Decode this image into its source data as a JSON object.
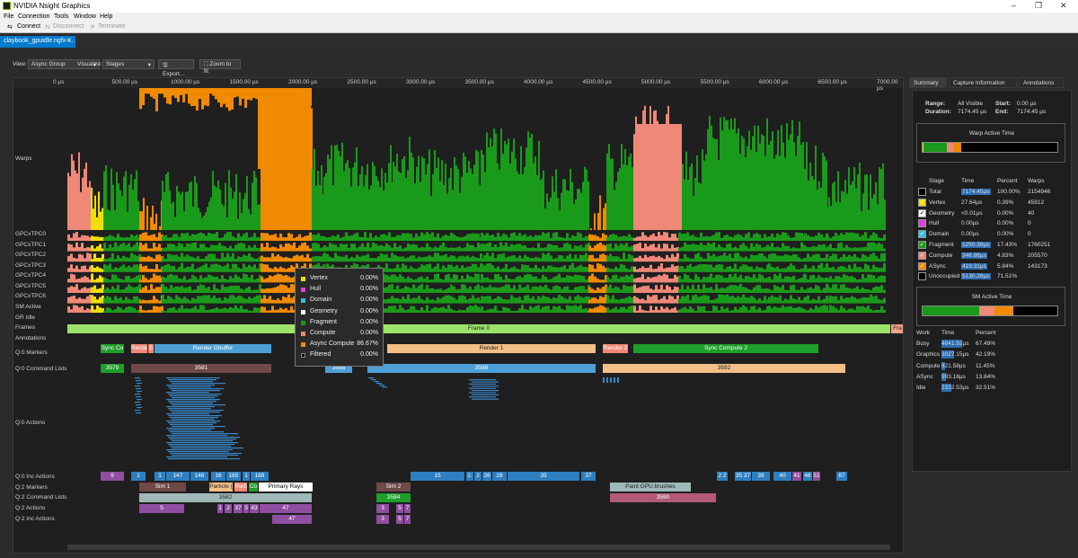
{
  "app": {
    "title": "NVIDIA Nsight Graphics",
    "menu": [
      "File",
      "Connection",
      "Tools",
      "Window",
      "Help"
    ],
    "toolbar": {
      "connect": "Connect",
      "disconnect": "Disconnect",
      "terminate": "Terminate"
    }
  },
  "document_tab": {
    "label": "claybook_gpuidle.ngfx-..."
  },
  "view_options": {
    "view_label": "View:",
    "view_value": "Async Group",
    "visualize_label": "Visualize:",
    "visualize_value": "Stages",
    "export_label": "Export...",
    "zoom_label": "Zoom to fit"
  },
  "timeline": {
    "ruler_ticks": [
      "0 µs",
      "500.00 µs",
      "1000.00 µs",
      "1500.00 µs",
      "2000.00 µs",
      "2500.00 µs",
      "3000.00 µs",
      "3500.00 µs",
      "4000.00 µs",
      "4500.00 µs",
      "5000.00 µs",
      "5500.00 µs",
      "6000.00 µs",
      "6500.00 µs",
      "7000.00 µs"
    ],
    "row_labels": {
      "warps": "Warps",
      "tpc": [
        "GPCxTPC0",
        "GPCxTPC1",
        "GPCxTPC2",
        "GPCxTPC3",
        "GPCxTPC4",
        "GPCxTPC5",
        "GPCxTPC6"
      ],
      "sm_active": "SM Active",
      "gr_idle": "GR Idle",
      "frames": "Frames",
      "annotations": "Annotations",
      "q0_markers": "Q:0 Markers",
      "q0_cmdlists": "Q:0 Command Lists",
      "q0_actions": "Q:0 Actions",
      "q0_inc_actions": "Q:0 Inc Actions",
      "q2_markers": "Q:2 Markers",
      "q2_cmdlists": "Q:2 Command Lists",
      "q2_actions": "Q:2 Actions",
      "q2_inc_actions": "Q:2 Inc Actions"
    },
    "frame_label": "Frame 0",
    "frame_label_end": "Fra",
    "q0_markers": {
      "sync_c0": "Sync Co",
      "render_short": "Rende",
      "render_5": "5",
      "render_gbuffer": "Render Gbuffer",
      "render_1": "Render 1",
      "render_2": "Render 2",
      "sync_compute_2": "Sync Compute 2"
    },
    "q0_cmdlists": {
      "a": "3579",
      "b": "3581",
      "c": "3588",
      "d": "3592",
      "mid": "3586"
    },
    "q0_inc": {
      "n9": "9",
      "n1": "1",
      "n1b": "1",
      "n147": "147",
      "n148": "148",
      "n16": "16",
      "n165": "165",
      "n1c": "1",
      "n188": "188",
      "n15": "15",
      "n1x": "1:",
      "n2": "2",
      "n26": "26",
      "n28": "28",
      "n35": "35",
      "n37": "37",
      "n22": "2 2",
      "n3537": "35 37",
      "n39": "39",
      "n40": "40",
      "n41": "41",
      "n46": "46",
      "n51": "51",
      "n87": "87"
    },
    "q2_markers": {
      "sim1": "Sim 1",
      "particle": "Particle (",
      "parti": "Parti",
      "co": "Co",
      "primary_rays": "Primary Rays",
      "sim2": "Sim 2",
      "paint": "Paint GPU brushes"
    },
    "q2_cmdlists": {
      "a": "3582",
      "b": "3584",
      "c": "3590"
    },
    "q2_actions": {
      "a": "5",
      "b": "1",
      "c": "2",
      "d": "37",
      "e": "3",
      "f": "43",
      "g": "47",
      "h": "3",
      "i": "5",
      "j": "7"
    },
    "q2_inc": {
      "a": "47",
      "b": "3",
      "c": "5",
      "d": "7"
    }
  },
  "tooltip": {
    "items": [
      {
        "name": "Vertex",
        "pct": "0.00%",
        "color": "#f0e000"
      },
      {
        "name": "Hull",
        "pct": "0.00%",
        "color": "#e040e0"
      },
      {
        "name": "Domain",
        "pct": "0.00%",
        "color": "#30c0e0"
      },
      {
        "name": "Geometry",
        "pct": "0.00%",
        "color": "#ffffff"
      },
      {
        "name": "Fragment",
        "pct": "0.00%",
        "color": "#1a9a1a"
      },
      {
        "name": "Compute",
        "pct": "0.00%",
        "color": "#f08878"
      },
      {
        "name": "Async Compute",
        "pct": "86.67%",
        "color": "#f08a00"
      },
      {
        "name": "Filtered",
        "pct": "0.00%",
        "color": "#000000"
      }
    ]
  },
  "right_panel": {
    "tabs": [
      "Summary",
      "Capture Information",
      "Annotations"
    ],
    "range_label": "Range:",
    "range_value": "All Visible",
    "start_label": "Start:",
    "start_value": "0.00 µs",
    "duration_label": "Duration:",
    "duration_value": "7174.45 µs",
    "end_label": "End:",
    "end_value": "7174.45 µs",
    "warp_active_title": "Warp Active Time",
    "stage_headers": [
      "Stage",
      "Time",
      "Percent",
      "Warps"
    ],
    "stages": [
      {
        "name": "Total",
        "time": "7174.45µs",
        "percent": "100.00%",
        "warps": "2154946",
        "color": "#000000",
        "checked": false
      },
      {
        "name": "Vertex",
        "time": "27.64µs",
        "percent": "0.39%",
        "warps": "45912",
        "color": "#f0e000",
        "checked": true
      },
      {
        "name": "Geometry",
        "time": "<0.01µs",
        "percent": "0.00%",
        "warps": "40",
        "color": "#ffffff",
        "checked": true
      },
      {
        "name": "Hull",
        "time": "0.00µs",
        "percent": "0.00%",
        "warps": "0",
        "color": "#e040e0",
        "checked": false
      },
      {
        "name": "Domain",
        "time": "0.00µs",
        "percent": "0.00%",
        "warps": "0",
        "color": "#30c0e0",
        "checked": true
      },
      {
        "name": "Fragment",
        "time": "1250.38µs",
        "percent": "17.43%",
        "warps": "1760251",
        "color": "#1a9a1a",
        "checked": true
      },
      {
        "name": "Compute",
        "time": "346.86µs",
        "percent": "4.83%",
        "warps": "205570",
        "color": "#f08878",
        "checked": true
      },
      {
        "name": "ASync",
        "time": "419.31µs",
        "percent": "5.84%",
        "warps": "143173",
        "color": "#f08a00",
        "checked": true
      },
      {
        "name": "Unoccupied",
        "time": "5130.26µs",
        "percent": "71.51%",
        "warps": "",
        "color": "#000000",
        "checked": false
      }
    ],
    "sm_active_title": "SM Active Time",
    "work_headers": [
      "Work",
      "Time",
      "Percent"
    ],
    "work": [
      {
        "name": "Busy",
        "time": "4841.92µs",
        "percent": "67.49%",
        "frac": 0.675
      },
      {
        "name": "Graphics",
        "time": "3027.15µs",
        "percent": "42.19%",
        "frac": 0.42
      },
      {
        "name": "Compute",
        "time": "821.58µs",
        "percent": "11.45%",
        "frac": 0.115
      },
      {
        "name": "ASync",
        "time": "993.18µs",
        "percent": "13.84%",
        "frac": 0.14
      },
      {
        "name": "Idle",
        "time": "2332.53µs",
        "percent": "32.51%",
        "frac": 0.325
      }
    ]
  }
}
